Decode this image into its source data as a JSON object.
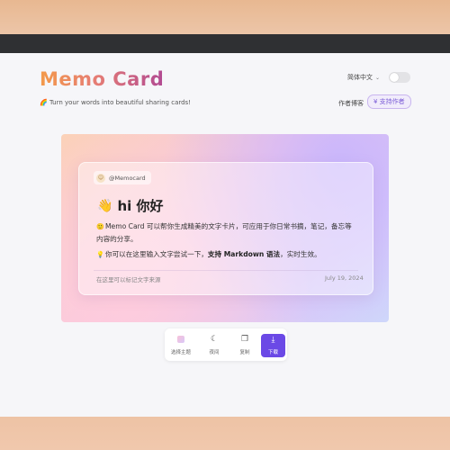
{
  "header": {
    "title": "Memo Card",
    "tagline": "🌈 Turn your words into beautiful sharing cards!",
    "language": "简体中文",
    "author_link": "作者博客",
    "support_button": "¥ 支持作者"
  },
  "card": {
    "handle": "@Memocard",
    "heading": "hi 你好",
    "line1_prefix": "Memo Card 可以帮你生成精美的文字卡片，可应用于你日常书摘，笔记，备忘等内容的分享。",
    "line2_prefix": "你可以在这里输入文字尝试一下，",
    "line2_bold": "支持 Markdown 语法",
    "line2_suffix": "，实时生效。",
    "source_placeholder": "在这里可以标记文字来源",
    "date": "July 19, 2024"
  },
  "toolbar": {
    "theme_label": "选择主题",
    "dark_label": "夜间",
    "copy_label": "复制",
    "download_label": "下载"
  },
  "colors": {
    "accent": "#6b49e6",
    "title_gradient_start": "#f39a4a",
    "title_gradient_end": "#b24a92"
  },
  "icons": {
    "wave": "waving-hand-icon",
    "bulb": "lightbulb-icon",
    "moon": "moon-icon",
    "copy": "copy-icon",
    "download": "download-icon"
  }
}
